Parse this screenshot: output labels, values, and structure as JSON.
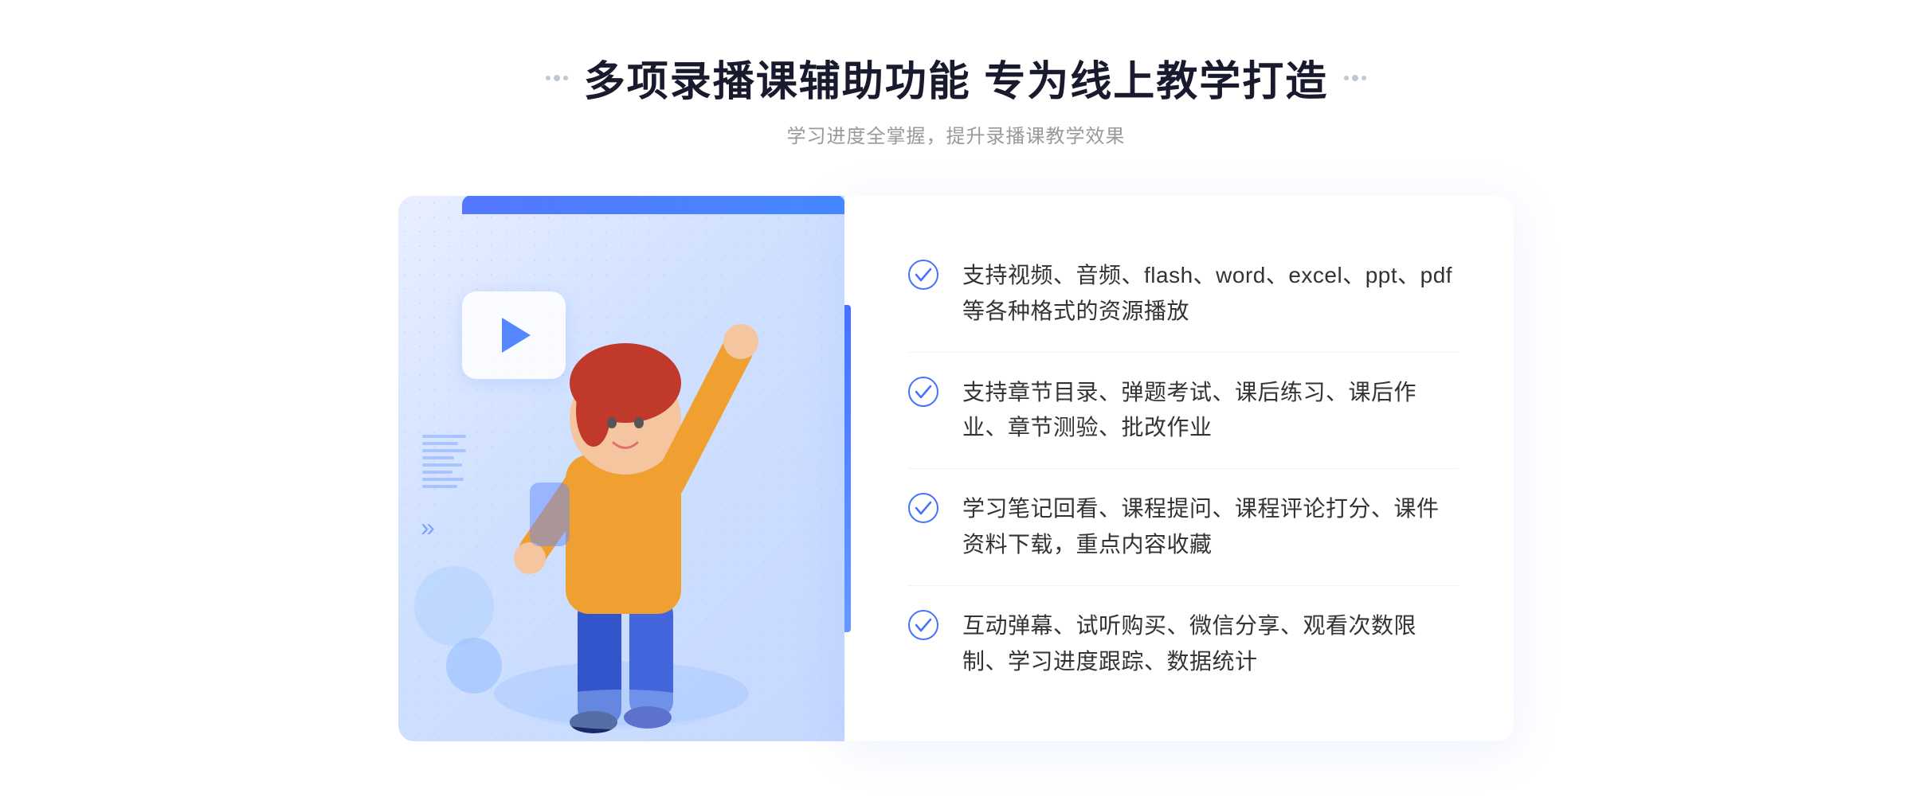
{
  "header": {
    "title": "多项录播课辅助功能 专为线上教学打造",
    "subtitle": "学习进度全掌握，提升录播课教学效果"
  },
  "decorative": {
    "dots_left": "⁞⁞",
    "dots_right": "⁞⁞",
    "arrow_left": "»"
  },
  "features": [
    {
      "id": 1,
      "text": "支持视频、音频、flash、word、excel、ppt、pdf等各种格式的资源播放"
    },
    {
      "id": 2,
      "text": "支持章节目录、弹题考试、课后练习、课后作业、章节测验、批改作业"
    },
    {
      "id": 3,
      "text": "学习笔记回看、课程提问、课程评论打分、课件资料下载，重点内容收藏"
    },
    {
      "id": 4,
      "text": "互动弹幕、试听购买、微信分享、观看次数限制、学习进度跟踪、数据统计"
    }
  ],
  "colors": {
    "accent_blue": "#4472ff",
    "light_blue": "#6699ff",
    "title_dark": "#1a1a2e",
    "text_gray": "#333333",
    "subtitle_gray": "#999999"
  }
}
